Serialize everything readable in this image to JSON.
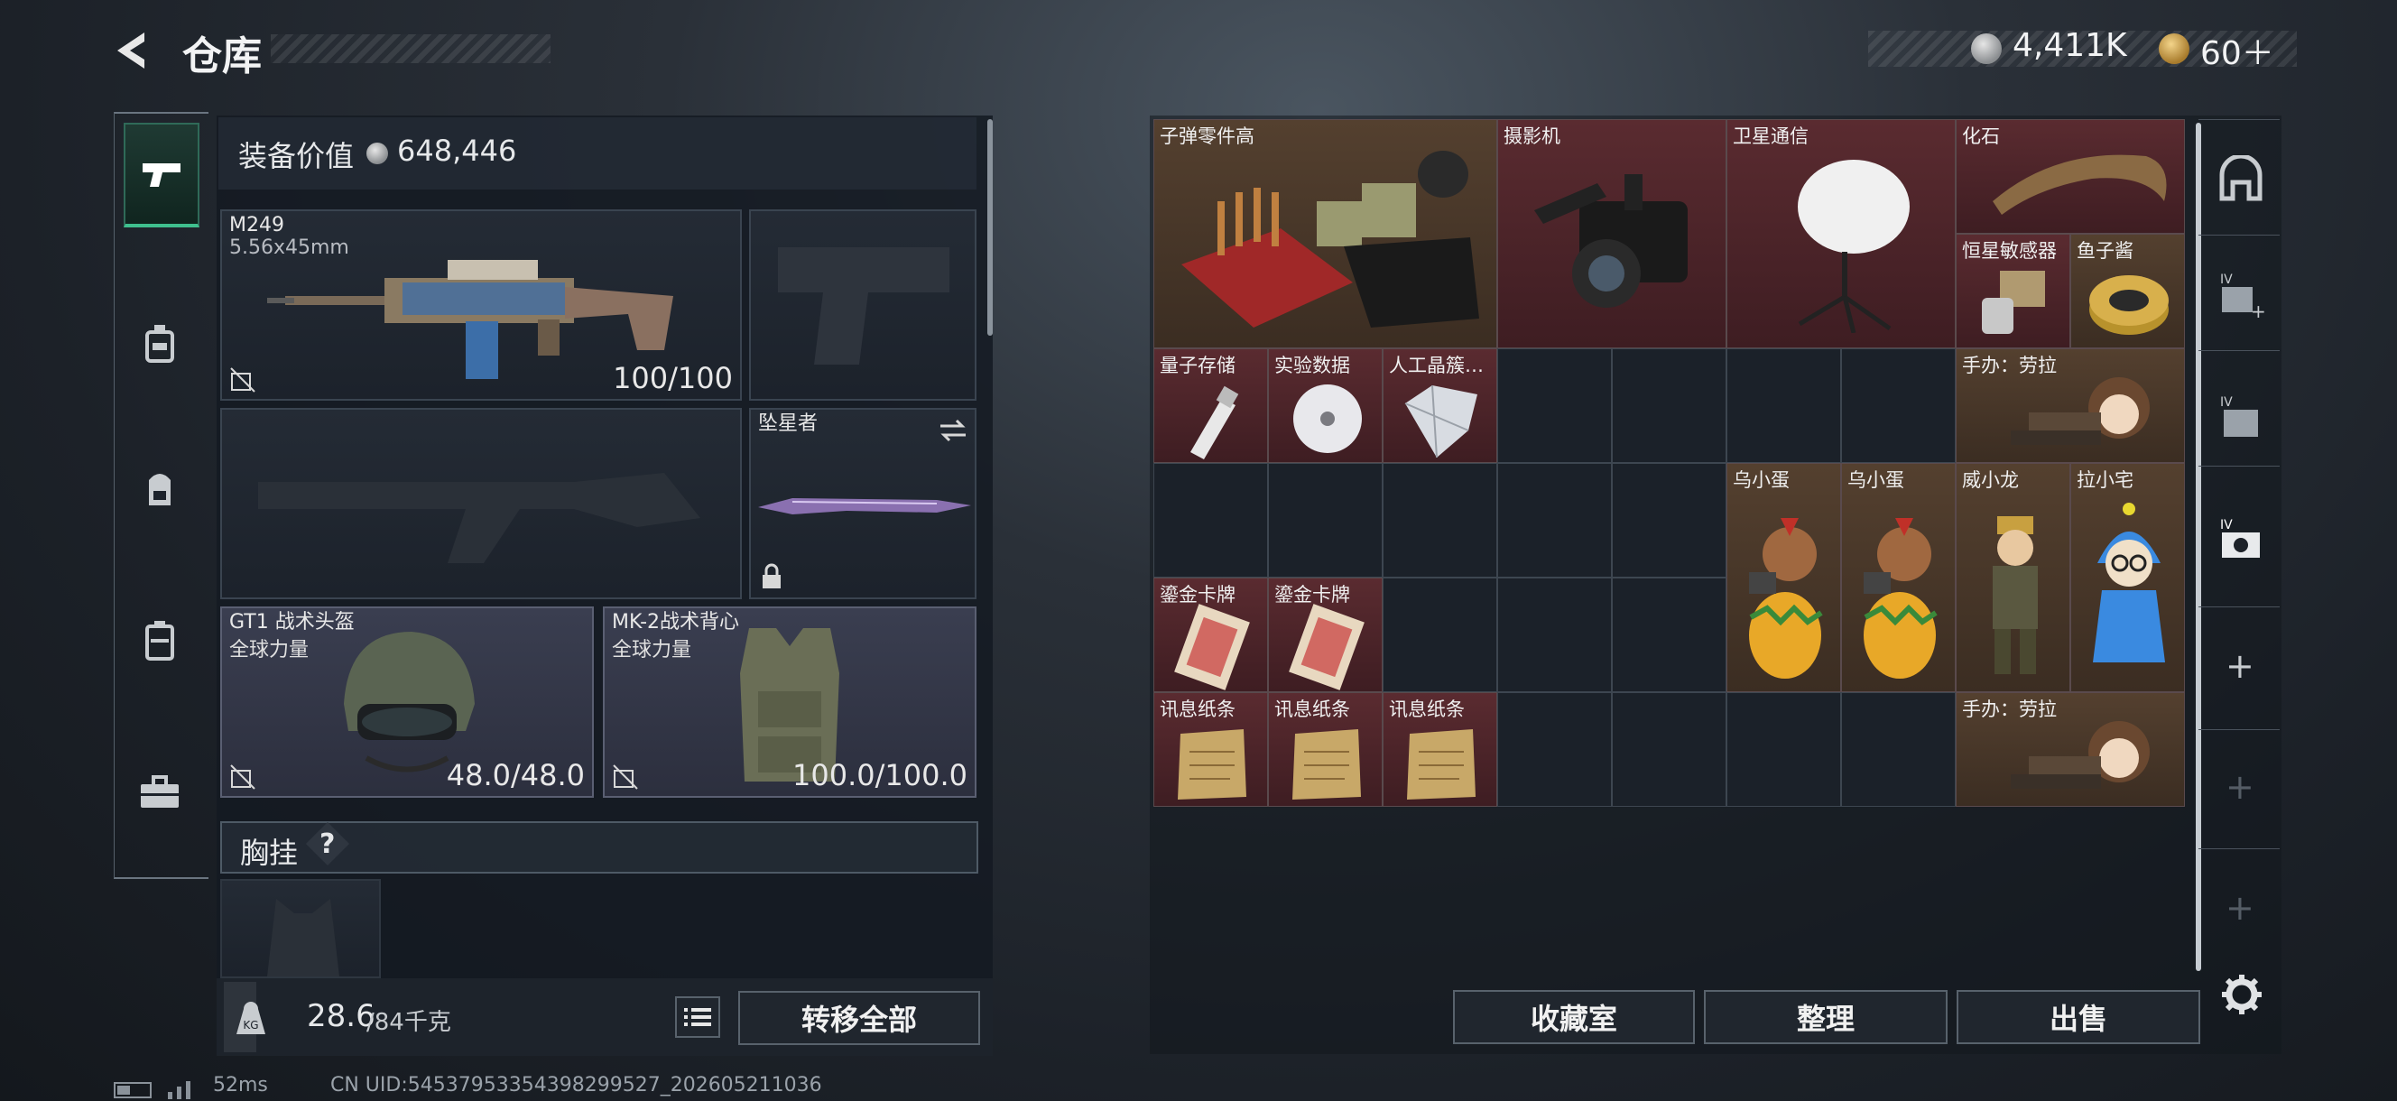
{
  "header": {
    "title": "仓库",
    "currency": [
      {
        "icon": "silver-coin-icon",
        "value": "4,411K"
      },
      {
        "icon": "gold-coin-icon",
        "value": "60＋"
      }
    ]
  },
  "left_nav": [
    "pistol-icon",
    "backpack-rig-icon",
    "backpack-icon",
    "case-icon",
    "toolbox-icon"
  ],
  "equipment": {
    "value_label": "装备价值",
    "value": "648,446",
    "slots": {
      "primary": {
        "name": "M249",
        "ammo": "5.56x45mm",
        "durability": "100/100"
      },
      "melee": {
        "name": "坠星者"
      },
      "helmet": {
        "name": "GT1 战术头盔",
        "sub": "全球力量",
        "durability": "48.0/48.0"
      },
      "armor": {
        "name": "MK-2战术背心",
        "sub": "全球力量",
        "durability": "100.0/100.0"
      }
    },
    "chest_rig_label": "胸挂",
    "help": "?",
    "weight": "28.6",
    "weight_max": "/84千克",
    "transfer_all": "转移全部"
  },
  "items": [
    {
      "label": "子弹零件高",
      "color": "brown"
    },
    {
      "label": "摄影机",
      "color": "red"
    },
    {
      "label": "卫星通信",
      "color": "red"
    },
    {
      "label": "化石",
      "color": "red"
    },
    {
      "label": "恒星敏感器",
      "color": "red"
    },
    {
      "label": "鱼子酱",
      "color": "brown"
    },
    {
      "label": "量子存储",
      "color": "red"
    },
    {
      "label": "实验数据",
      "color": "red"
    },
    {
      "label": "人工晶簇…",
      "color": "red"
    },
    {
      "label": "手办：劳拉",
      "color": "brown"
    },
    {
      "label": "乌小蛋",
      "color": "brown"
    },
    {
      "label": "乌小蛋",
      "color": "brown"
    },
    {
      "label": "威小龙",
      "color": "brown"
    },
    {
      "label": "拉小宅",
      "color": "brown"
    },
    {
      "label": "鎏金卡牌",
      "color": "red"
    },
    {
      "label": "鎏金卡牌",
      "color": "red"
    },
    {
      "label": "讯息纸条",
      "color": "red"
    },
    {
      "label": "讯息纸条",
      "color": "red"
    },
    {
      "label": "讯息纸条",
      "color": "red"
    },
    {
      "label": "手办：劳拉",
      "color": "brown"
    }
  ],
  "actions": {
    "collection": "收藏室",
    "sort": "整理",
    "sell": "出售"
  },
  "right_nav": {
    "tier": "IV",
    "add": "+"
  },
  "status": {
    "ping": "52ms",
    "uid": "CN UID:54537953354398299527_202605211036"
  }
}
